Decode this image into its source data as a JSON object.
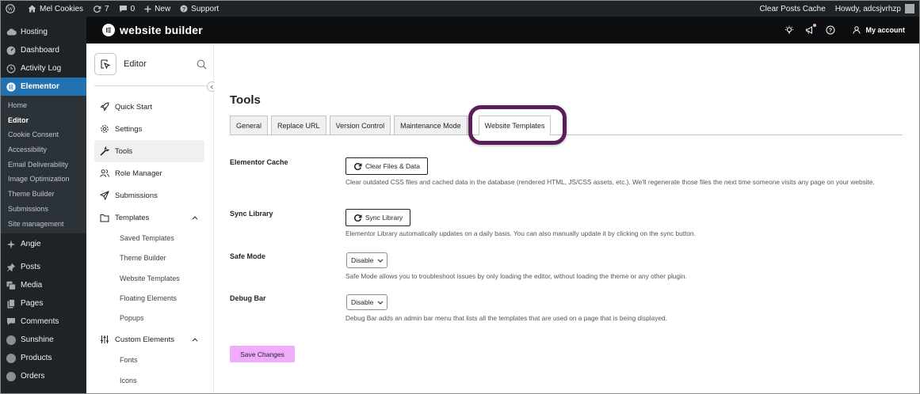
{
  "admin_bar": {
    "site_name": "Mel Cookies",
    "updates_count": "7",
    "comments_count": "0",
    "new_label": "New",
    "support_label": "Support",
    "clear_cache_label": "Clear Posts Cache",
    "howdy_label": "Howdy, adcsjvrhzp"
  },
  "admin_menu": {
    "items_top": [
      "Hosting",
      "Dashboard",
      "Activity Log"
    ],
    "elementor_label": "Elementor",
    "elementor_sub": [
      "Home",
      "Editor",
      "Cookie Consent",
      "Accessibility",
      "Email Deliverability",
      "Image Optimization",
      "Theme Builder",
      "Submissions",
      "Site management"
    ],
    "items_bottom": [
      "Angie",
      "Posts",
      "Media",
      "Pages",
      "Comments",
      "Sunshine",
      "Products",
      "Orders"
    ]
  },
  "elementor_bar": {
    "brand": "website builder",
    "account_label": "My account"
  },
  "panel": {
    "title": "Editor",
    "nav": [
      "Quick Start",
      "Settings",
      "Tools",
      "Role Manager",
      "Submissions",
      "Templates"
    ],
    "templates_sub": [
      "Saved Templates",
      "Theme Builder",
      "Website Templates",
      "Floating Elements",
      "Popups"
    ],
    "custom_elements_label": "Custom Elements",
    "custom_sub": [
      "Fonts",
      "Icons"
    ]
  },
  "main": {
    "title": "Tools",
    "tabs": [
      "General",
      "Replace URL",
      "Version Control",
      "Maintenance Mode",
      "Website Templates"
    ],
    "cache": {
      "label": "Elementor Cache",
      "button": "Clear Files & Data",
      "desc": "Clear outdated CSS files and cached data in the database (rendered HTML, JS/CSS assets, etc.). We'll regenerate those files the next time someone visits any page on your website."
    },
    "sync": {
      "label": "Sync Library",
      "button": "Sync Library",
      "desc": "Elementor Library automatically updates on a daily basis. You can also manually update it by clicking on the sync button."
    },
    "safe_mode": {
      "label": "Safe Mode",
      "value": "Disable",
      "desc": "Safe Mode allows you to troubleshoot issues by only loading the editor, without loading the theme or any other plugin."
    },
    "debug_bar": {
      "label": "Debug Bar",
      "value": "Disable",
      "desc": "Debug Bar adds an admin bar menu that lists all the templates that are used on a page that is being displayed."
    },
    "save_button": "Save Changes"
  },
  "colors": {
    "wp_dark": "#1d2327",
    "wp_blue": "#2271b1",
    "save_pink": "#f0abfc",
    "highlight_purple": "#5c1e5b"
  }
}
